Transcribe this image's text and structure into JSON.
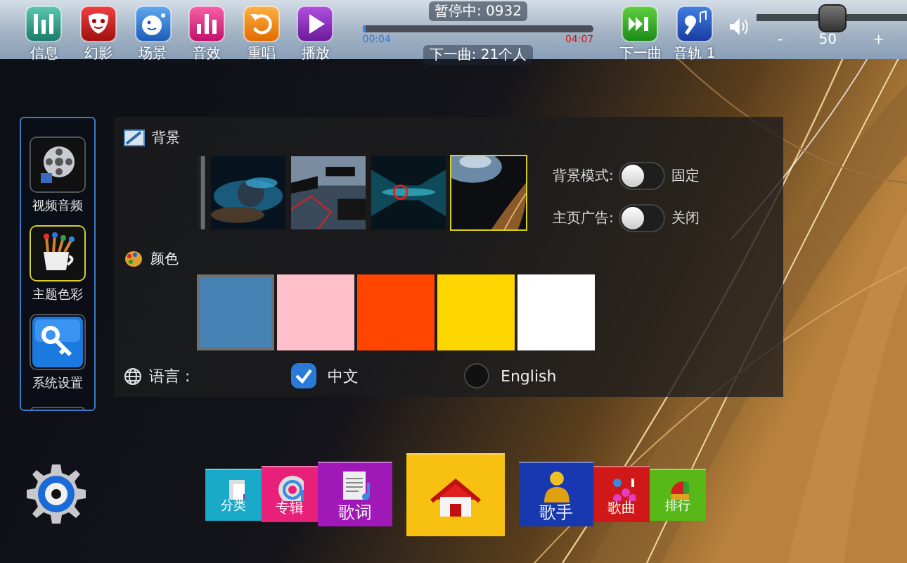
{
  "top_bar": {
    "buttons": [
      {
        "label": "信息"
      },
      {
        "label": "幻影"
      },
      {
        "label": "场景"
      },
      {
        "label": "音效"
      },
      {
        "label": "重唱"
      },
      {
        "label": "播放"
      }
    ],
    "playback": {
      "status": "暂停中: 0932",
      "level": 0.016,
      "elapsed": "00:04",
      "total": "04:07",
      "next_up": "下一曲: 21个人"
    },
    "right_buttons": [
      {
        "label": "下一曲"
      },
      {
        "label": "音轨 1"
      }
    ],
    "volume": {
      "level": 0.5,
      "minus": "-",
      "value": "50",
      "plus": "+"
    }
  },
  "sidebar": {
    "items": [
      {
        "label": "视频音频",
        "selected": false
      },
      {
        "label": "主题色彩",
        "selected": true
      },
      {
        "label": "系统设置",
        "selected": false
      }
    ]
  },
  "settings": {
    "background": {
      "title": "背景",
      "thumbnails": [
        {
          "kind": "partial",
          "selected": false
        },
        {
          "kind": "full",
          "selected": false
        },
        {
          "kind": "full",
          "selected": false
        },
        {
          "kind": "full",
          "selected": false
        },
        {
          "kind": "full",
          "selected": true
        }
      ],
      "options": [
        {
          "label": "背景模式:",
          "on": false,
          "value": "固定"
        },
        {
          "label": "主页广告:",
          "on": false,
          "value": "关闭"
        }
      ]
    },
    "colors": {
      "title": "颜色",
      "swatches": [
        {
          "color": "#4682b4",
          "selected": true
        },
        {
          "color": "#ffc0cb",
          "selected": false
        },
        {
          "color": "#ff4500",
          "selected": false
        },
        {
          "color": "#ffd700",
          "selected": false
        },
        {
          "color": "#ffffff",
          "selected": false
        }
      ]
    },
    "language": {
      "label": "语言 :",
      "options": [
        {
          "label": "中文",
          "selected": true
        },
        {
          "label": "English",
          "selected": false
        }
      ]
    }
  },
  "bottom_nav": [
    {
      "kind": "small",
      "label": "分类",
      "color": "#19a9c9"
    },
    {
      "kind": "medium",
      "label": "专辑",
      "color": "#e8207a"
    },
    {
      "kind": "large",
      "label": "歌词",
      "color": "#a018b8"
    },
    {
      "kind": "home",
      "color": "#f8c010"
    },
    {
      "kind": "large",
      "label": "歌手",
      "color": "#1838b0"
    },
    {
      "kind": "medium",
      "label": "歌曲",
      "color": "#d01818"
    },
    {
      "kind": "small",
      "label": "排行",
      "color": "#58b818"
    }
  ]
}
